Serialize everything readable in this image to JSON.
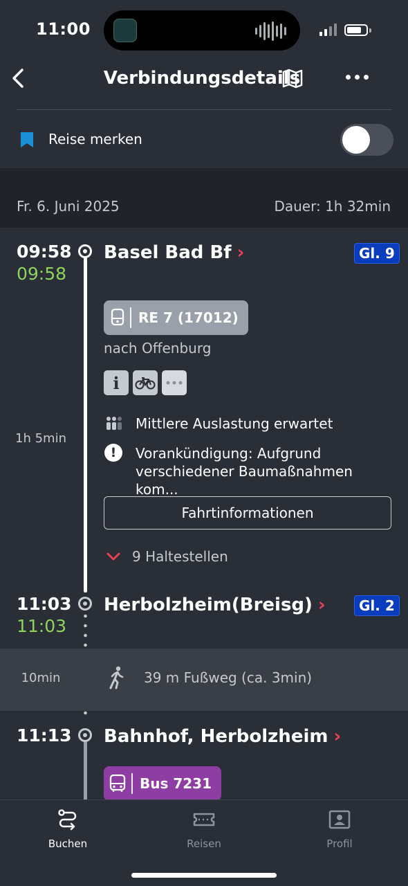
{
  "status_bar": {
    "time": "11:00"
  },
  "header": {
    "title": "Verbindungsdetails"
  },
  "bookmark": {
    "label": "Reise merken",
    "enabled": false
  },
  "trip": {
    "date": "Fr. 6. Juni 2025",
    "duration": "Dauer: 1h 32min"
  },
  "stops": [
    {
      "time": "09:58",
      "live_time": "09:58",
      "name": "Basel Bad Bf",
      "platform": "Gl. 9"
    },
    {
      "time": "11:03",
      "live_time": "11:03",
      "name": "Herbolzheim(Breisg)",
      "platform": "Gl. 2"
    },
    {
      "time": "11:13",
      "name": "Bahnhof, Herbolzheim"
    }
  ],
  "leg1": {
    "travel_time": "1h 5min",
    "train": "RE 7 (17012)",
    "direction": "nach Offenburg",
    "attribute_icons": [
      "info-icon",
      "bicycle-icon",
      "more-icon"
    ],
    "occupancy": "Mittlere Auslastung erwartet",
    "notice_line1": "Vorankündigung: Aufgrund",
    "notice_line2": "verschiedener Baumaßnahmen kom...",
    "details_button": "Fahrtinformationen",
    "stops_toggle": "9 Haltestellen"
  },
  "walk": {
    "duration": "10min",
    "text": "39 m Fußweg (ca. 3min)"
  },
  "leg2": {
    "bus": "Bus 7231"
  },
  "tabs": [
    {
      "label": "Buchen",
      "icon": "route-icon",
      "active": true
    },
    {
      "label": "Reisen",
      "icon": "ticket-icon",
      "active": false
    },
    {
      "label": "Profil",
      "icon": "profile-icon",
      "active": false
    }
  ],
  "colors": {
    "background": "#2a2e37",
    "live_time": "#8fd35f",
    "accent_red": "#ee4055",
    "platform_blue": "#0a3dbd",
    "train_badge": "#9aa0aa",
    "bus_badge": "#8e3da3",
    "bookmark": "#1a8fd6"
  }
}
